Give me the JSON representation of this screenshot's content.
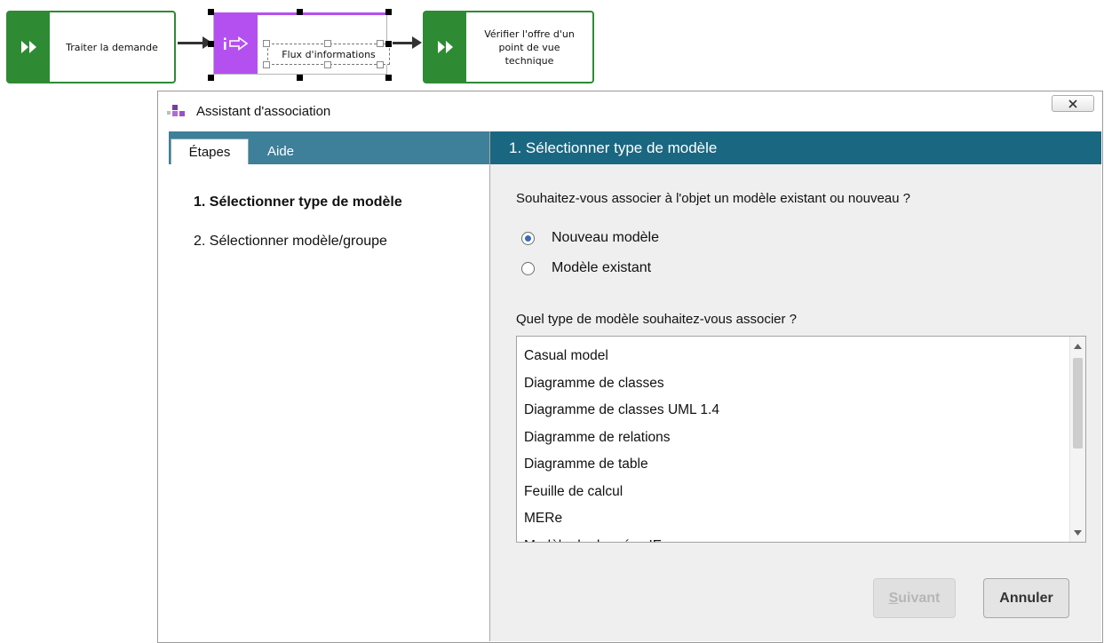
{
  "diagram": {
    "shapes": [
      {
        "label": "Traiter la demande",
        "color": "#2e8b34",
        "icon": "play-double-icon"
      },
      {
        "label": "Flux d'informations",
        "color": "#b450f0",
        "icon": "information-flow-icon"
      },
      {
        "label": "Vérifier l'offre d'un point de vue technique",
        "color": "#2e8b34",
        "icon": "play-double-icon"
      }
    ]
  },
  "dialog": {
    "title": "Assistant d'association",
    "close_icon": "close-x-icon",
    "tabs": [
      {
        "label": "Étapes",
        "active": true
      },
      {
        "label": "Aide",
        "active": false
      }
    ],
    "steps": [
      {
        "label": "1. Sélectionner type de modèle",
        "current": true
      },
      {
        "label": "2. Sélectionner modèle/groupe",
        "current": false
      }
    ],
    "header": "1. Sélectionner type de modèle",
    "question1": "Souhaitez-vous associer à l'objet un modèle existant ou nouveau ?",
    "radios": [
      {
        "label": "Nouveau modèle",
        "checked": true
      },
      {
        "label": "Modèle existant",
        "checked": false
      }
    ],
    "question2": "Quel type de modèle souhaitez-vous associer ?",
    "model_types": [
      "Casual model",
      "Diagramme de classes",
      "Diagramme de classes UML 1.4",
      "Diagramme de relations",
      "Diagramme de table",
      "Feuille de calcul",
      "MERe",
      "Modèle de données IE"
    ],
    "buttons": {
      "next_accel": "S",
      "next_rest": "uivant",
      "next_enabled": false,
      "cancel": "Annuler"
    },
    "colors": {
      "header_bar": "#1a6782",
      "tab_strip": "#3e7f99",
      "radio_selected": "#3b6bb5"
    }
  }
}
